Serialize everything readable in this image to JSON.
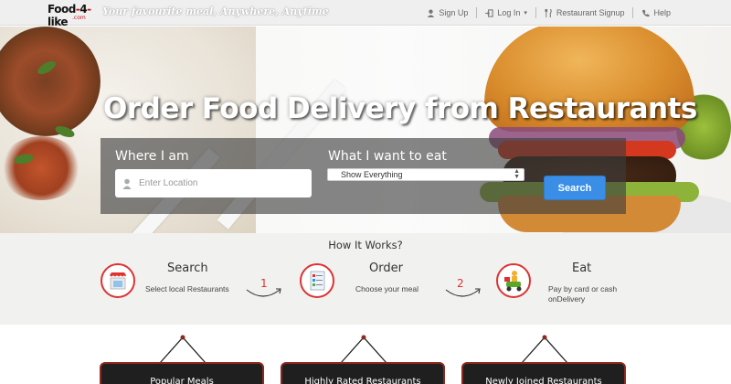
{
  "brand": {
    "logo_text": "Food4like",
    "logo_sub": ".com",
    "tagline": "Your favourite meal, Anywhere, Anytime"
  },
  "nav": {
    "signup": "Sign Up",
    "login": "Log In",
    "restaurant_signup": "Restaurant Signup",
    "help": "Help"
  },
  "hero": {
    "headline": "Order Food Delivery from Restaurants",
    "where_label": "Where I am",
    "location_placeholder": "Enter Location",
    "what_label": "What I want to eat",
    "select_value": "Show Everything",
    "search_button": "Search"
  },
  "how": {
    "title": "How It Works?",
    "steps": [
      {
        "title": "Search",
        "desc": "Select local Restaurants"
      },
      {
        "title": "Order",
        "desc": "Choose your meal"
      },
      {
        "title": "Eat",
        "desc": "Pay by card or cash onDelivery"
      }
    ],
    "numbers": [
      "1",
      "2"
    ]
  },
  "boards": [
    "Popular Meals",
    "Highly Rated Restaurants",
    "Newly Joined Restaurants"
  ],
  "colors": {
    "accent_red": "#d33333",
    "search_blue": "#3a8ee6"
  }
}
